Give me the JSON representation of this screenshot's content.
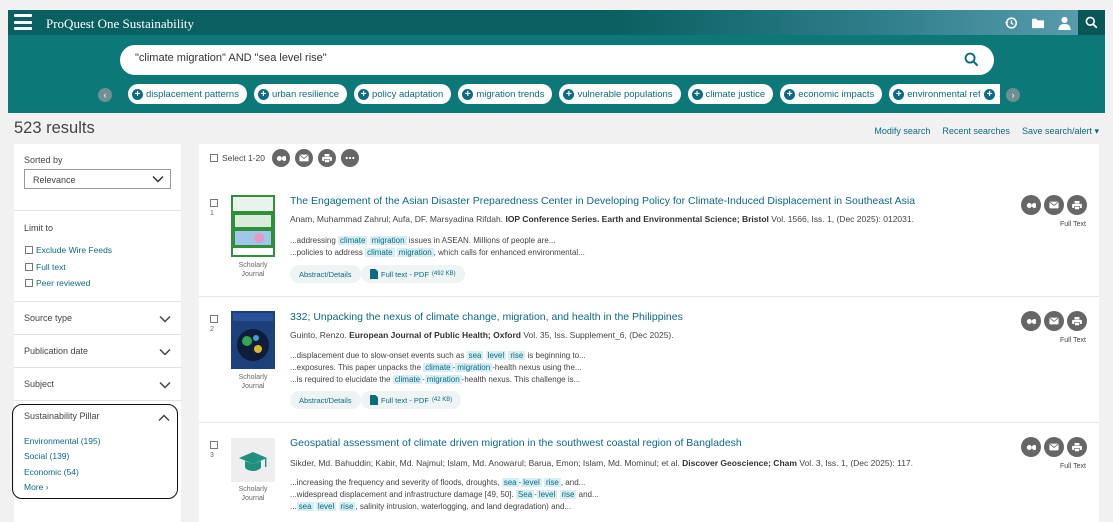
{
  "app": {
    "title": "ProQuest One Sustainability",
    "brand_color": "#0c7877",
    "link_color": "#0b6b80"
  },
  "header_icons": [
    "history-icon",
    "folder-icon",
    "user-icon",
    "search-icon"
  ],
  "search": {
    "query": "\"climate migration\" AND \"sea level rise\""
  },
  "chips": [
    "displacement patterns",
    "urban resilience",
    "policy adaptation",
    "migration trends",
    "vulnerable populations",
    "climate justice",
    "economic impacts",
    "environmental refugees"
  ],
  "results_header": {
    "count": "523 results",
    "modify": "Modify search",
    "recent": "Recent searches",
    "save": "Save search/alert ▾"
  },
  "sidebar": {
    "sorted_by": "Sorted by",
    "sort_value": "Relevance",
    "limit_to": "Limit to",
    "limits": [
      "Exclude Wire Feeds",
      "Full text",
      "Peer reviewed"
    ],
    "facets": [
      "Source type",
      "Publication date",
      "Subject"
    ],
    "pillar": {
      "title": "Sustainability Pillar",
      "items": [
        "Environmental (195)",
        "Social (139)",
        "Economic (54)"
      ],
      "more": "More ›"
    }
  },
  "toolbar": {
    "select_label": "Select 1-20"
  },
  "results": [
    {
      "num": "1",
      "title": "The Engagement of the Asian Disaster Preparedness Center in Developing Policy for Climate-Induced Displacement in Southeast Asia",
      "authors": "Anam, Muhammad Zahrul; Aufa, DF. Marsyadina Rifdah.",
      "source": "IOP Conference Series. Earth and Environmental Science; Bristol",
      "details": "Vol. 1566, Iss. 1,  (Dec 2025): 012031.",
      "type": "Scholarly Journal",
      "abstract_label": "Abstract/Details",
      "fulltext_label": "Full text - PDF",
      "pdf_size": "(492 KB)",
      "full_text": "Full Text"
    },
    {
      "num": "2",
      "title": "332; Unpacking the nexus of climate change, migration, and health in the Philippines",
      "authors": "Guinto, Renzo.",
      "source": "European Journal of Public Health; Oxford",
      "details": "Vol. 35, Iss. Supplement_6,  (Dec 2025).",
      "type": "Scholarly Journal",
      "abstract_label": "Abstract/Details",
      "fulltext_label": "Full text - PDF",
      "pdf_size": "(42 KB)",
      "full_text": "Full Text"
    },
    {
      "num": "3",
      "title": "Geospatial assessment of climate driven migration in the southwest coastal region of Bangladesh",
      "authors": "Sikder, Md. Bahuddin; Kabir, Md. Najmul; Islam, Md. Anowarul; Barua, Emon; Islam, Md. Mominul; et al.",
      "source": "Discover Geoscience; Cham",
      "details": "Vol. 3, Iss. 1,  (Dec 2025): 117.",
      "type": "Scholarly Journal",
      "full_text": "Full Text"
    }
  ],
  "snippets": {
    "r1a": [
      "...addressing",
      "climate",
      "migration",
      "issues in ASEAN. Millions of people are..."
    ],
    "r1b": [
      "...policies to address",
      "climate",
      "migration",
      ", which calls for enhanced environmental..."
    ],
    "r2a": [
      "...displacement due to slow-onset events such as",
      "sea",
      "level",
      "rise",
      "is beginning to..."
    ],
    "r2b": [
      "...exposures. This paper unpacks the",
      "climate",
      "-",
      "migration",
      "-health nexus using the..."
    ],
    "r2c": [
      "...is required to elucidate the",
      "climate",
      "-",
      "migration",
      "-health nexus. This challenge is..."
    ],
    "r3a": [
      "...increasing the frequency and severity of floods, droughts,",
      "sea",
      "-",
      "level",
      "rise",
      ", and..."
    ],
    "r3b": [
      "...widespread displacement and infrastructure damage [49, 50].",
      "Sea",
      "-",
      "level",
      "rise",
      "and..."
    ],
    "r3c": [
      "...",
      "sea",
      "level",
      "rise",
      ", salinity intrusion, waterlogging, and land degradation) and..."
    ]
  }
}
